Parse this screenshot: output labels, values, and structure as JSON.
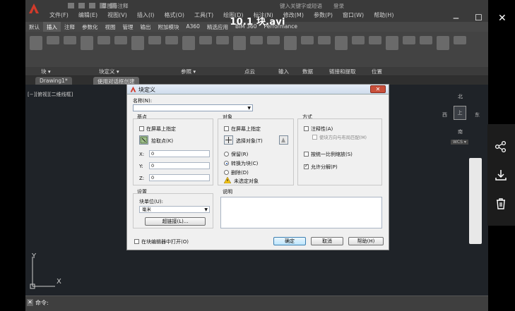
{
  "video": {
    "title": "10.1 块.avi",
    "minimize_label": "‒",
    "maximize_label": "☐",
    "close_label": "✕"
  },
  "app": {
    "doc_name": "草图与注释",
    "top_right": [
      "键入关键字或短语",
      "登录"
    ],
    "menus": [
      "文件(F)",
      "编辑(E)",
      "视图(V)",
      "插入(I)",
      "格式(O)",
      "工具(T)",
      "绘图(D)",
      "标注(N)",
      "修改(M)",
      "参数(P)",
      "窗口(W)",
      "帮助(H)"
    ],
    "ribbon_tabs": [
      "默认",
      "插入",
      "注释",
      "参数化",
      "视图",
      "管理",
      "输出",
      "附加模块",
      "A360",
      "精选应用",
      "BIM 360",
      "Performance"
    ],
    "active_tab_index": 1,
    "panels": [
      "块 ▾",
      "块定义 ▾",
      "参照 ▾",
      "点云",
      "输入",
      "数据",
      "链接和提取",
      "位置"
    ],
    "doc_tabs": [
      "Drawing1*",
      "使用对话框创建"
    ],
    "viewport_label": "[−][俯视][二维线框]",
    "viewcube": {
      "top": "北",
      "left": "西",
      "right": "东",
      "center": "上",
      "bottom": "南",
      "wcs": "WCS ▾"
    },
    "ucs": {
      "x": "X",
      "y": "Y"
    },
    "cmd_label": "命令:",
    "cmd_close": "✕"
  },
  "dialog": {
    "title": "块定义",
    "close": "✕",
    "name_label": "名称(N):",
    "name_value": "",
    "base": {
      "title": "基点",
      "onscreen_label": "在屏幕上指定",
      "onscreen_checked": false,
      "pick_label": "拾取点(K)",
      "x_label": "X:",
      "x_value": "0",
      "y_label": "Y:",
      "y_value": "0",
      "z_label": "Z:",
      "z_value": "0"
    },
    "objects": {
      "title": "对象",
      "onscreen_label": "在屏幕上指定",
      "onscreen_checked": false,
      "select_label": "选择对象(T)",
      "retain_label": "保留(R)",
      "convert_label": "转换为块(C)",
      "delete_label": "删除(D)",
      "selected": "convert",
      "warning": "未选定对象"
    },
    "behavior": {
      "title": "方式",
      "annotative_label": "注释性(A)",
      "annotative_checked": false,
      "match_label": "使块方向与布局匹配(M)",
      "match_checked": false,
      "uniform_label": "按统一比例缩放(S)",
      "uniform_checked": false,
      "explode_label": "允许分解(P)",
      "explode_checked": true
    },
    "settings": {
      "title": "设置",
      "unit_label": "块单位(U):",
      "unit_value": "毫米",
      "hyperlink_label": "超链接(L)..."
    },
    "description_label": "说明",
    "open_in_editor_label": "在块编辑器中打开(O)",
    "open_in_editor_checked": false,
    "ok_label": "确定",
    "cancel_label": "取消",
    "help_label": "帮助(H)"
  },
  "side_actions": [
    "share-icon",
    "download-icon",
    "delete-icon"
  ]
}
